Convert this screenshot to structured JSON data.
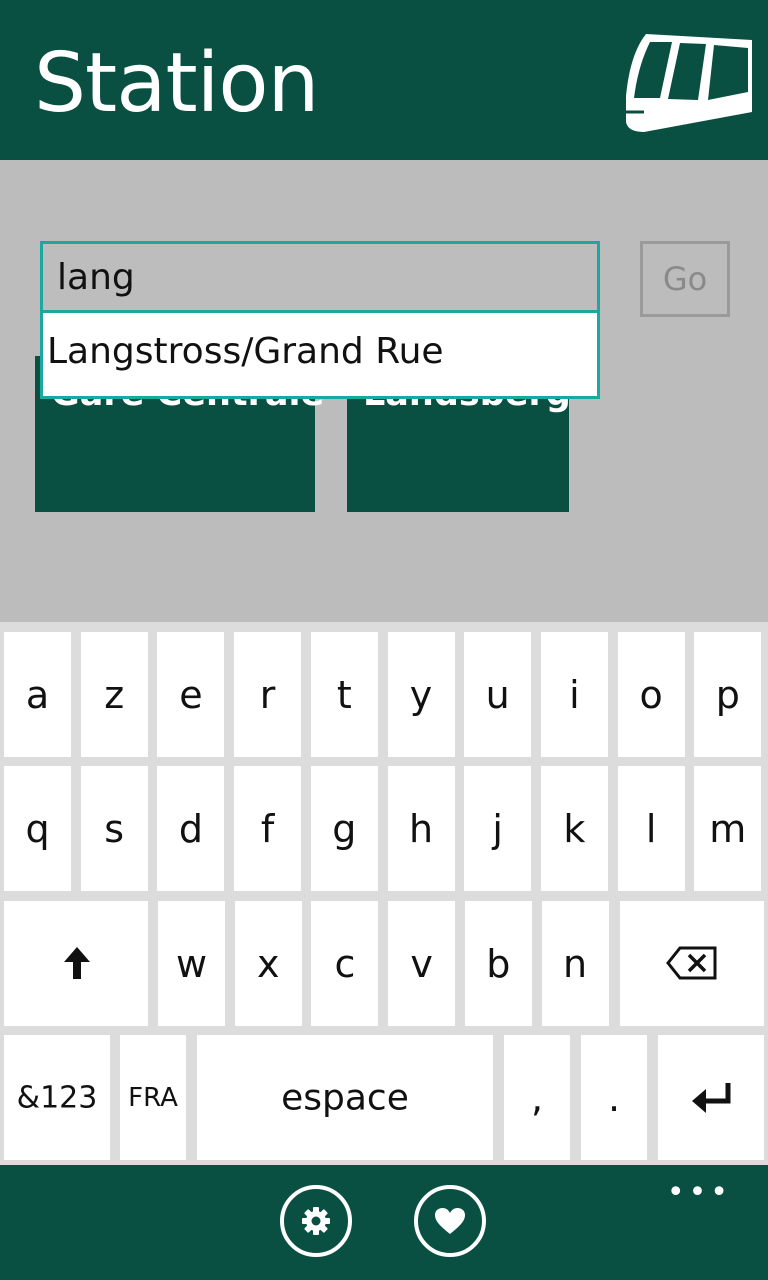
{
  "header": {
    "title": "Station"
  },
  "search": {
    "value": "lang",
    "go_label": "Go"
  },
  "suggestions": [
    {
      "label": "Langstross/Grand Rue"
    }
  ],
  "favorites": [
    {
      "label": "Gare Centrale"
    },
    {
      "label": "Landsberg"
    }
  ],
  "keyboard": {
    "row1": [
      "a",
      "z",
      "e",
      "r",
      "t",
      "y",
      "u",
      "i",
      "o",
      "p"
    ],
    "row2": [
      "q",
      "s",
      "d",
      "f",
      "g",
      "h",
      "j",
      "k",
      "l",
      "m"
    ],
    "row3": [
      "w",
      "x",
      "c",
      "v",
      "b",
      "n"
    ],
    "numbers_label": "&123",
    "language_label": "FRA",
    "space_label": "espace",
    "comma_label": ",",
    "period_label": "."
  },
  "appbar": {
    "more_label": "•••"
  },
  "colors": {
    "accent": "#0a5042",
    "input_border": "#1aa8a0"
  }
}
